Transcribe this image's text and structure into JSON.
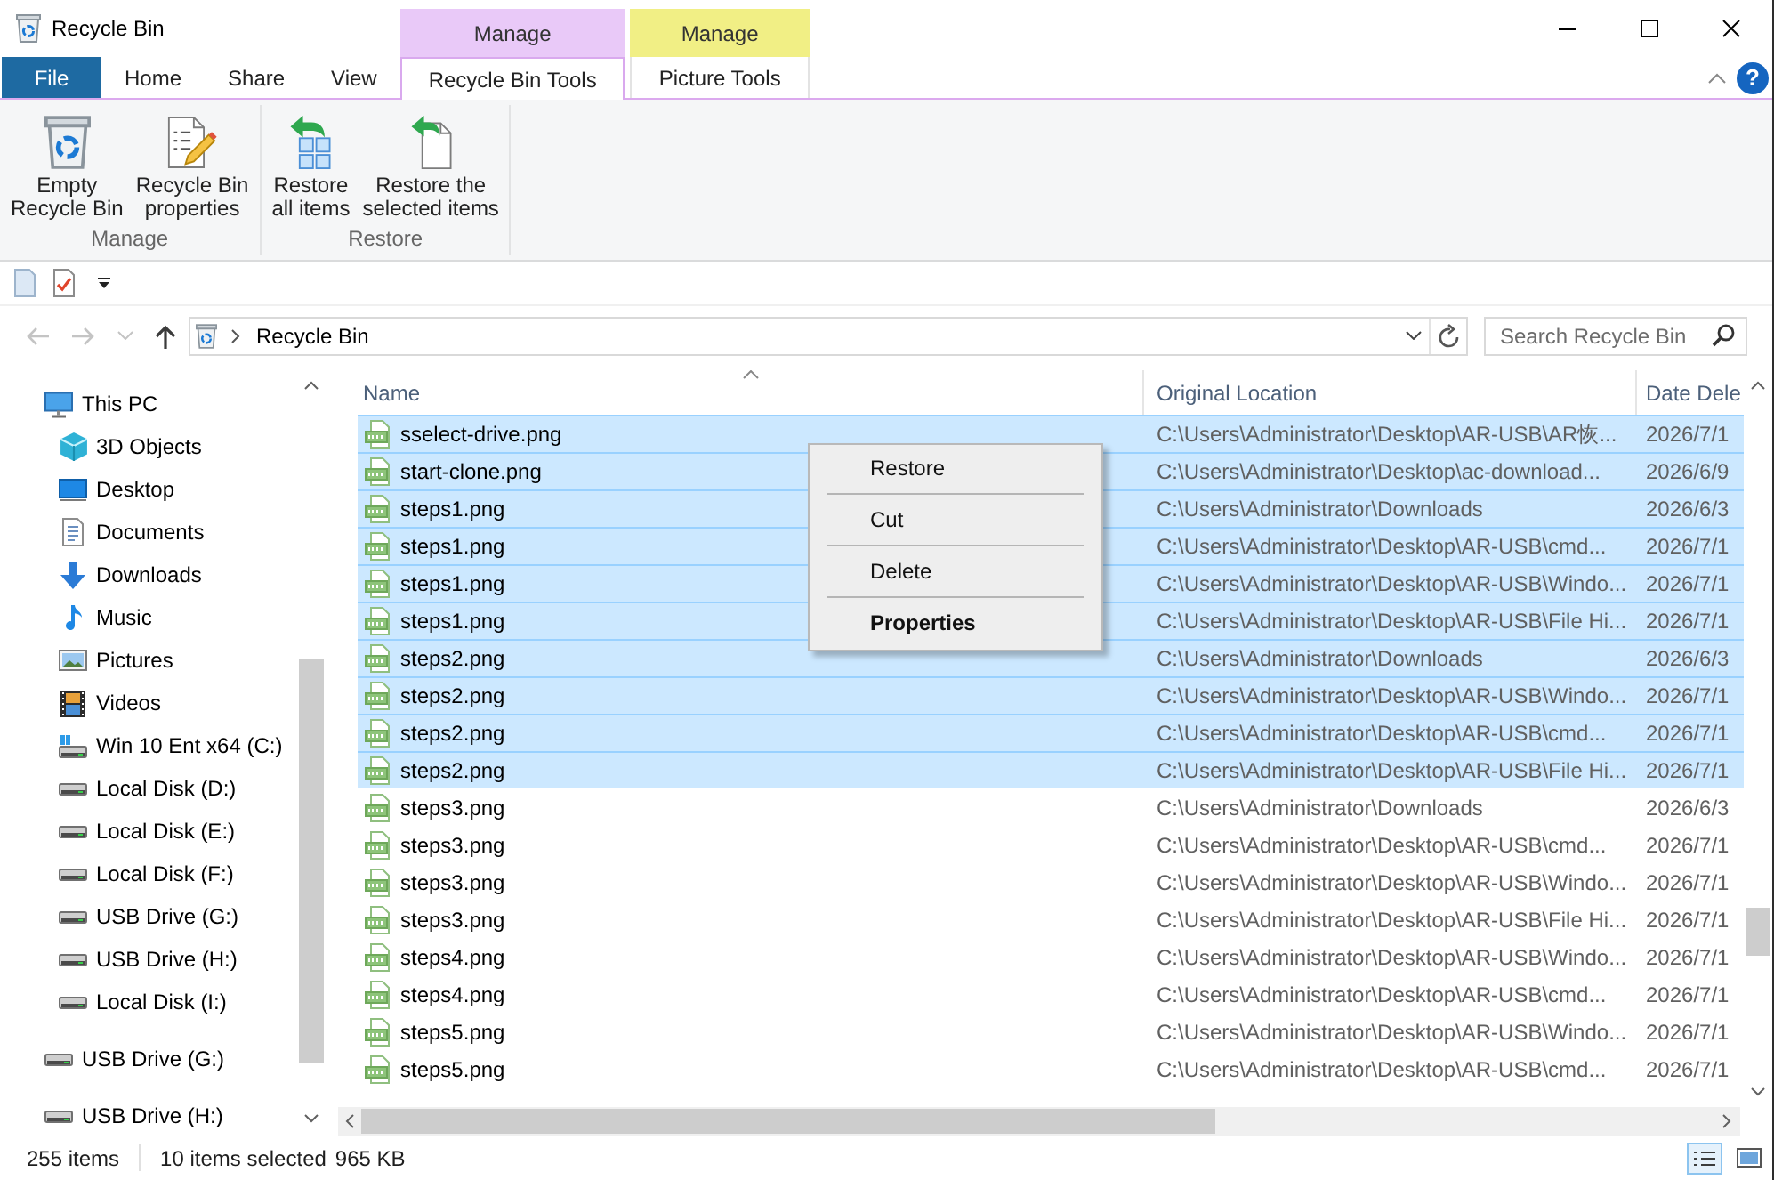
{
  "window": {
    "title": "Recycle Bin"
  },
  "ribbon": {
    "tabs": [
      {
        "label": "File",
        "kind": "file",
        "selected": false
      },
      {
        "label": "Home",
        "kind": "plain",
        "selected": false
      },
      {
        "label": "Share",
        "kind": "plain",
        "selected": false
      },
      {
        "label": "View",
        "kind": "plain",
        "selected": false
      },
      {
        "label": "Recycle Bin Tools",
        "kind": "contextual",
        "header": "Manage",
        "color": "#e9c9f8",
        "selected": true
      },
      {
        "label": "Picture Tools",
        "kind": "contextual",
        "header": "Manage",
        "color": "#f1ef85",
        "selected": false
      }
    ],
    "help": "?",
    "groups": [
      {
        "label": "Manage",
        "buttons": [
          {
            "label": "Empty\nRecycle Bin",
            "kind": "empty_bin"
          },
          {
            "label": "Recycle Bin\nproperties",
            "kind": "properties"
          }
        ]
      },
      {
        "label": "Restore",
        "buttons": [
          {
            "label": "Restore\nall items",
            "kind": "restore_all"
          },
          {
            "label": "Restore the\nselected items",
            "kind": "restore_selected"
          }
        ]
      }
    ]
  },
  "navigation": {
    "buttons": [
      {
        "kind": "back",
        "disabled": true
      },
      {
        "kind": "forward",
        "disabled": true
      },
      {
        "kind": "recent",
        "disabled": true
      },
      {
        "kind": "up",
        "disabled": false
      }
    ],
    "path": [
      "Recycle Bin"
    ],
    "search": {
      "placeholder": "Search Recycle Bin"
    }
  },
  "sidebar": {
    "items": [
      {
        "label": "This PC",
        "kind": "pc",
        "children": [
          {
            "label": "3D Objects",
            "kind": "objects_3d"
          },
          {
            "label": "Desktop",
            "kind": "desktop"
          },
          {
            "label": "Documents",
            "kind": "documents"
          },
          {
            "label": "Downloads",
            "kind": "downloads"
          },
          {
            "label": "Music",
            "kind": "music"
          },
          {
            "label": "Pictures",
            "kind": "pictures"
          },
          {
            "label": "Videos",
            "kind": "videos"
          },
          {
            "label": "Win 10 Ent x64 (C:)",
            "kind": "system_drive"
          },
          {
            "label": "Local Disk (D:)",
            "kind": "drive"
          },
          {
            "label": "Local Disk (E:)",
            "kind": "drive"
          },
          {
            "label": "Local Disk (F:)",
            "kind": "drive"
          },
          {
            "label": "USB Drive (G:)",
            "kind": "drive"
          },
          {
            "label": "USB Drive (H:)",
            "kind": "drive"
          },
          {
            "label": "Local Disk (I:)",
            "kind": "drive"
          }
        ]
      },
      {
        "label": "USB Drive (G:)",
        "kind": "drive"
      },
      {
        "label": "USB Drive (H:)",
        "kind": "drive"
      }
    ]
  },
  "file_list": {
    "columns": [
      {
        "label": "Name",
        "sorted": true
      },
      {
        "label": "Original Location",
        "sorted": false
      },
      {
        "label": "Date Dele",
        "sorted": false
      }
    ],
    "rows": [
      {
        "name": "sselect-drive.png",
        "location": "C:\\Users\\Administrator\\Desktop\\AR-USB\\AR恢...",
        "column_3": "2026/7/1",
        "selected": true
      },
      {
        "name": "start-clone.png",
        "location": "C:\\Users\\Administrator\\Desktop\\ac-download...",
        "column_3": "2026/6/9",
        "selected": true
      },
      {
        "name": "steps1.png",
        "location": "C:\\Users\\Administrator\\Downloads",
        "column_3": "2026/6/3",
        "selected": true
      },
      {
        "name": "steps1.png",
        "location": "C:\\Users\\Administrator\\Desktop\\AR-USB\\cmd...",
        "column_3": "2026/7/1",
        "selected": true
      },
      {
        "name": "steps1.png",
        "location": "C:\\Users\\Administrator\\Desktop\\AR-USB\\Windo...",
        "column_3": "2026/7/1",
        "selected": true
      },
      {
        "name": "steps1.png",
        "location": "C:\\Users\\Administrator\\Desktop\\AR-USB\\File Hi...",
        "column_3": "2026/7/1",
        "selected": true
      },
      {
        "name": "steps2.png",
        "location": "C:\\Users\\Administrator\\Downloads",
        "column_3": "2026/6/3",
        "selected": true
      },
      {
        "name": "steps2.png",
        "location": "C:\\Users\\Administrator\\Desktop\\AR-USB\\Windo...",
        "column_3": "2026/7/1",
        "selected": true
      },
      {
        "name": "steps2.png",
        "location": "C:\\Users\\Administrator\\Desktop\\AR-USB\\cmd...",
        "column_3": "2026/7/1",
        "selected": true
      },
      {
        "name": "steps2.png",
        "location": "C:\\Users\\Administrator\\Desktop\\AR-USB\\File Hi...",
        "column_3": "2026/7/1",
        "selected": true
      },
      {
        "name": "steps3.png",
        "location": "C:\\Users\\Administrator\\Downloads",
        "column_3": "2026/6/3",
        "selected": false
      },
      {
        "name": "steps3.png",
        "location": "C:\\Users\\Administrator\\Desktop\\AR-USB\\cmd...",
        "column_3": "2026/7/1",
        "selected": false
      },
      {
        "name": "steps3.png",
        "location": "C:\\Users\\Administrator\\Desktop\\AR-USB\\Windo...",
        "column_3": "2026/7/1",
        "selected": false
      },
      {
        "name": "steps3.png",
        "location": "C:\\Users\\Administrator\\Desktop\\AR-USB\\File Hi...",
        "column_3": "2026/7/1",
        "selected": false
      },
      {
        "name": "steps4.png",
        "location": "C:\\Users\\Administrator\\Desktop\\AR-USB\\Windo...",
        "column_3": "2026/7/1",
        "selected": false
      },
      {
        "name": "steps4.png",
        "location": "C:\\Users\\Administrator\\Desktop\\AR-USB\\cmd...",
        "column_3": "2026/7/1",
        "selected": false
      },
      {
        "name": "steps5.png",
        "location": "C:\\Users\\Administrator\\Desktop\\AR-USB\\Windo...",
        "column_3": "2026/7/1",
        "selected": false
      },
      {
        "name": "steps5.png",
        "location": "C:\\Users\\Administrator\\Desktop\\AR-USB\\cmd...",
        "column_3": "2026/7/1",
        "selected": false
      }
    ]
  },
  "context_menu": {
    "items": [
      {
        "label": "Restore",
        "default": false,
        "separator_above": false
      },
      {
        "label": "Cut",
        "default": false,
        "separator_above": true
      },
      {
        "label": "Delete",
        "default": false,
        "separator_above": true
      },
      {
        "label": "Properties",
        "default": true,
        "separator_above": true
      }
    ]
  },
  "status_bar": {
    "item_count": "255 items",
    "selection": "10 items selected",
    "size": "965 KB",
    "views": [
      {
        "kind": "details",
        "selected": true
      },
      {
        "kind": "large_icons",
        "selected": false
      }
    ]
  }
}
